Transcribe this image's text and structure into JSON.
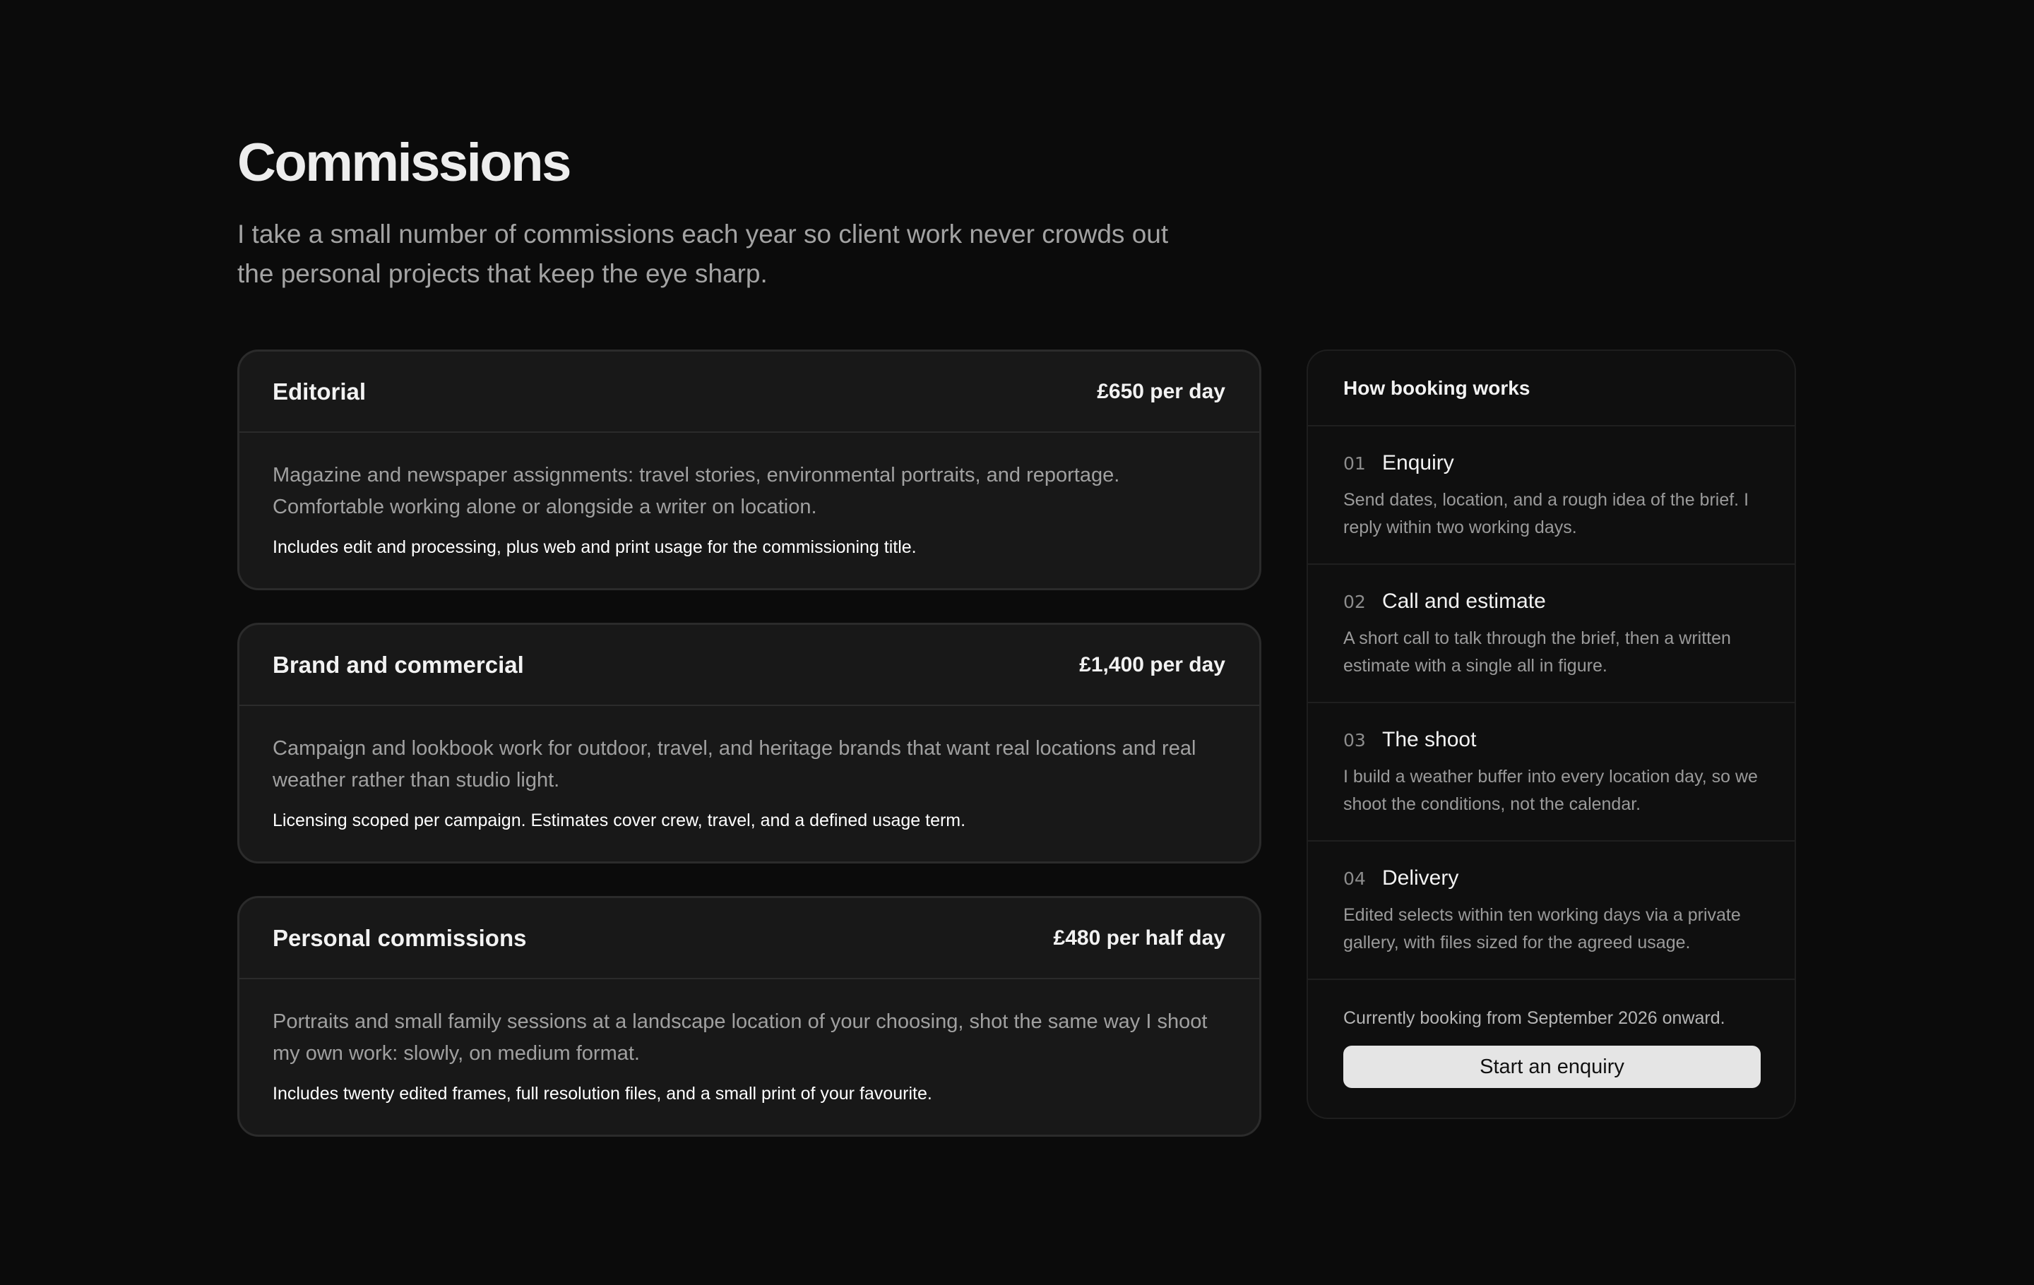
{
  "page": {
    "title": "Commissions",
    "intro": "I take a small number of commissions each year so client work never crowds out the personal projects that keep the eye sharp."
  },
  "services": [
    {
      "title": "Editorial",
      "price": "£650 per day",
      "description": "Magazine and newspaper assignments: travel stories, environmental portraits, and reportage. Comfortable working alone or alongside a writer on location.",
      "note": "Includes edit and processing, plus web and print usage for the commissioning title."
    },
    {
      "title": "Brand and commercial",
      "price": "£1,400 per day",
      "description": "Campaign and lookbook work for outdoor, travel, and heritage brands that want real locations and real weather rather than studio light.",
      "note": "Licensing scoped per campaign. Estimates cover crew, travel, and a defined usage term."
    },
    {
      "title": "Personal commissions",
      "price": "£480 per half day",
      "description": "Portraits and small family sessions at a landscape location of your choosing, shot the same way I shoot my own work: slowly, on medium format.",
      "note": "Includes twenty edited frames, full resolution files, and a small print of your favourite."
    }
  ],
  "booking": {
    "title": "How booking works",
    "steps": [
      {
        "number": "01",
        "title": "Enquiry",
        "description": "Send dates, location, and a rough idea of the brief. I reply within two working days."
      },
      {
        "number": "02",
        "title": "Call and estimate",
        "description": "A short call to talk through the brief, then a written estimate with a single all in figure."
      },
      {
        "number": "03",
        "title": "The shoot",
        "description": "I build a weather buffer into every location day, so we shoot the conditions, not the calendar."
      },
      {
        "number": "04",
        "title": "Delivery",
        "description": "Edited selects within ten working days via a private gallery, with files sized for the agreed usage."
      }
    ],
    "availability": "Currently booking from September 2026 onward.",
    "cta_label": "Start an enquiry"
  }
}
